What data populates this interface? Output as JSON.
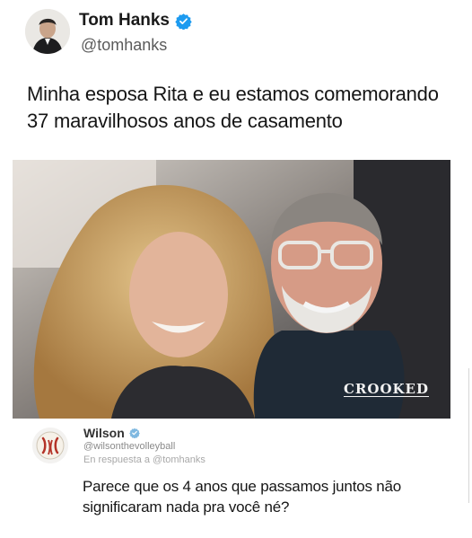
{
  "tweet": {
    "author_name": "Tom Hanks",
    "author_handle": "@tomhanks",
    "verified_icon": "verified-badge-icon",
    "text_lines": [
      "Minha esposa Rita e eu estamos comemorando",
      "37 maravilhosos anos de casamento"
    ]
  },
  "photo": {
    "watermark": "CROOKED"
  },
  "reply": {
    "author_name": "Wilson",
    "author_handle": "@wilsonthevolleyball",
    "context": "En respuesta a @tomhanks",
    "text_lines": [
      "Parece que os 4 anos que passamos juntos não",
      "significaram nada pra você né?"
    ]
  },
  "colors": {
    "verified_blue": "#1d9bf0",
    "text": "#151515",
    "handle": "#5b5b5b"
  }
}
